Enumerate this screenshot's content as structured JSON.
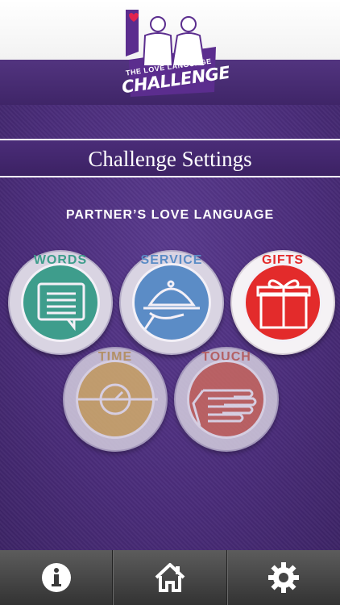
{
  "app": {
    "logo_small": "THE LOVE LANGUAGE",
    "logo_big": "CHALLENGE"
  },
  "header": {
    "title": "Challenge Settings"
  },
  "section": {
    "label": "PARTNER’S LOVE LANGUAGE"
  },
  "badges": [
    {
      "label": "WORDS",
      "icon": "speech-bubble-icon",
      "color": "#3e9d8c",
      "selected": false
    },
    {
      "label": "SERVICE",
      "icon": "serving-cloche-icon",
      "color": "#5b8cc6",
      "selected": false
    },
    {
      "label": "GIFTS",
      "icon": "gift-box-icon",
      "color": "#e32b2b",
      "selected": true
    },
    {
      "label": "TIME",
      "icon": "clock-icon",
      "color": "#d9b36a",
      "selected": false
    },
    {
      "label": "TOUCH",
      "icon": "hand-icon",
      "color": "#cf6b5e",
      "selected": false
    }
  ],
  "tabbar": {
    "items": [
      {
        "icon": "info-icon"
      },
      {
        "icon": "home-icon"
      },
      {
        "icon": "gear-icon"
      }
    ]
  },
  "colors": {
    "background": "#4a2f7a",
    "bar": "#444444"
  }
}
